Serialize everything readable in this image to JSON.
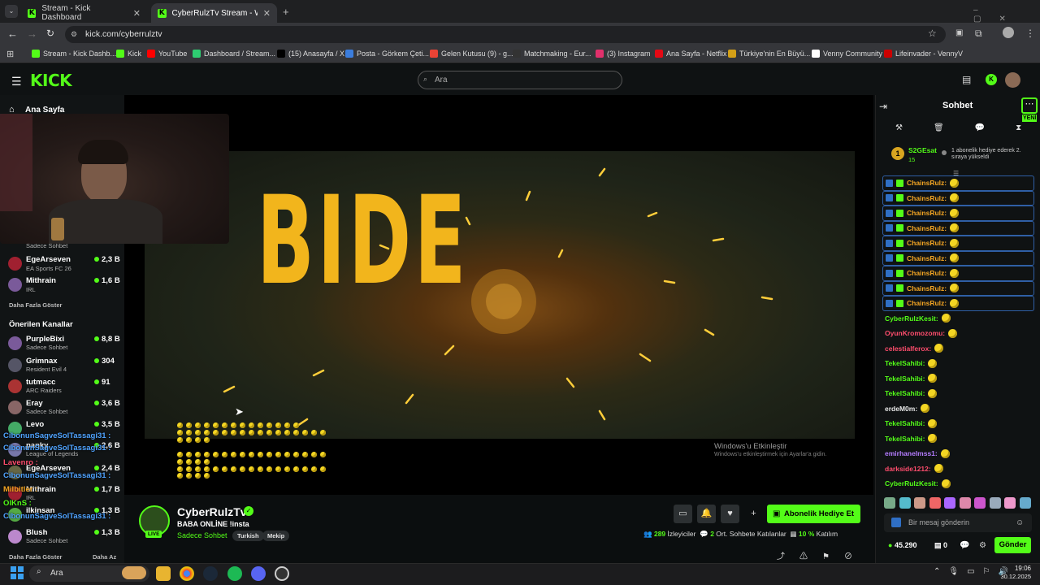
{
  "browser": {
    "tabs": [
      {
        "title": "Stream - Kick Dashboard",
        "active": false
      },
      {
        "title": "CyberRulzTv Stream - Watch Live",
        "active": true
      }
    ],
    "url": "kick.com/cyberrulztv",
    "bookmarks": [
      "Stream - Kick Dashb...",
      "Kick",
      "YouTube",
      "Dashboard / Stream...",
      "(15) Anasayfa / X",
      "Posta - Görkem Çeti...",
      "Gelen Kutusu (9) - g...",
      "Matchmaking - Eur...",
      "(3) Instagram",
      "Ana Sayfa - Netflix",
      "Türkiye'nin En Büyü...",
      "Venny Community",
      "Lifeinvader - VennyV"
    ]
  },
  "header": {
    "logo": "KICK",
    "search_placeholder": "Ara"
  },
  "sidebar": {
    "home_label": "Ana Sayfa",
    "followed": [
      {
        "sub": "Sadece Sohbet"
      },
      {
        "name": "EgeArseven",
        "sub": "EA Sports FC 26",
        "viewers": "2,3 B"
      },
      {
        "name": "Mithrain",
        "sub": "IRL",
        "viewers": "1,6 B"
      }
    ],
    "show_more": "Daha Fazla Göster",
    "recommended_title": "Önerilen Kanallar",
    "recommended": [
      {
        "name": "PurpleBixi",
        "sub": "Sadece Sohbet",
        "viewers": "8,8 B"
      },
      {
        "name": "Grimnax",
        "sub": "Resident Evil 4",
        "viewers": "304"
      },
      {
        "name": "tutmacc",
        "sub": "ARC Raiders",
        "viewers": "91"
      },
      {
        "name": "Eray",
        "sub": "Sadece Sohbet",
        "viewers": "3,6 B"
      },
      {
        "name": "Levo",
        "sub": "",
        "viewers": "3,5 B"
      },
      {
        "name": "panky",
        "sub": "League of Legends",
        "viewers": "2,6 B"
      },
      {
        "name": "EgeArseven",
        "sub": "",
        "viewers": "2,4 B"
      },
      {
        "name": "Mithrain",
        "sub": "IRL",
        "viewers": "1,7 B"
      },
      {
        "name": "ilkinsan",
        "sub": "",
        "viewers": "1,3 B"
      },
      {
        "name": "Blush",
        "sub": "Sadece Sohbet",
        "viewers": "1,3 B"
      }
    ],
    "show_more2": "Daha Fazla Göster",
    "show_less": "Daha Az",
    "overlay_chat": [
      "CibonunSagveSolTassagi31 :",
      "CibonunSagveSolTassagi31 :",
      "Lavenro :",
      "CibonunSagveSolTassagi31 :",
      "Milbitler :",
      "OlKnS :",
      "CibonunSagveSolTassagi31 :"
    ]
  },
  "video": {
    "title_text": "BIDE",
    "watermark_title": "Windows'u Etkinleştir",
    "watermark_sub": "Windows'u etkinleştirmek için Ayarlar'a gidin."
  },
  "channel": {
    "name": "CyberRulzTv",
    "live": "LIVE",
    "title": "BABA ONLİNE !insta",
    "category": "Sadece Sohbet",
    "tags": [
      "Turkish",
      "Mekip"
    ],
    "subscribe_gift": "Abonelik Hediye Et",
    "viewers": "289",
    "viewers_label": "İzleyiciler",
    "chatters": "2",
    "chatters_label": "Ort. Sohbete Katılanlar",
    "participation": "10 %",
    "participation_label": "Katılım"
  },
  "chat": {
    "title": "Sohbet",
    "new_badge": "YENİ",
    "pinned": {
      "rank": "1",
      "user": "S2GEsat",
      "count": "15",
      "text": "1 abonelik hediye ederek 2. sıraya yükseldi"
    },
    "messages": [
      {
        "user": "ChainsRulz:",
        "color": "#f5a623",
        "boxed": true
      },
      {
        "user": "ChainsRulz:",
        "color": "#f5a623",
        "boxed": true
      },
      {
        "user": "ChainsRulz:",
        "color": "#f5a623",
        "boxed": true
      },
      {
        "user": "ChainsRulz:",
        "color": "#f5a623",
        "boxed": true
      },
      {
        "user": "ChainsRulz:",
        "color": "#f5a623",
        "boxed": true
      },
      {
        "user": "ChainsRulz:",
        "color": "#f5a623",
        "boxed": true
      },
      {
        "user": "ChainsRulz:",
        "color": "#f5a623",
        "boxed": true
      },
      {
        "user": "ChainsRulz:",
        "color": "#f5a623",
        "boxed": true
      },
      {
        "user": "ChainsRulz:",
        "color": "#f5a623",
        "boxed": true
      },
      {
        "user": "CyberRulzKesit:",
        "color": "#53fc18",
        "boxed": false
      },
      {
        "user": "OyunKromozomu:",
        "color": "#ff4d6d",
        "boxed": false
      },
      {
        "user": "celestialferox:",
        "color": "#ff4d6d",
        "boxed": false
      },
      {
        "user": "TekelSahibi:",
        "color": "#53fc18",
        "boxed": false
      },
      {
        "user": "TekelSahibi:",
        "color": "#53fc18",
        "boxed": false
      },
      {
        "user": "TekelSahibi:",
        "color": "#53fc18",
        "boxed": false
      },
      {
        "user": "erdeM0m:",
        "color": "#e8e8e8",
        "boxed": false
      },
      {
        "user": "TekelSahibi:",
        "color": "#53fc18",
        "boxed": false
      },
      {
        "user": "TekelSahibi:",
        "color": "#53fc18",
        "boxed": false
      },
      {
        "user": "emirhanelmss1:",
        "color": "#b47cff",
        "boxed": false
      },
      {
        "user": "darkside1212:",
        "color": "#ff4d6d",
        "boxed": false
      },
      {
        "user": "CyberRulzKesit:",
        "color": "#53fc18",
        "boxed": false
      }
    ],
    "input_placeholder": "Bir mesaj gönderin",
    "points": "45.290",
    "count": "0",
    "send": "Gönder"
  },
  "taskbar": {
    "search": "Ara",
    "time": "19:06",
    "date": "30.12.2025"
  }
}
